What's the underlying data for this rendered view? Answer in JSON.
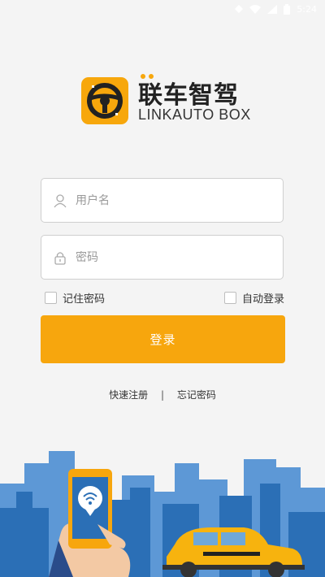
{
  "status": {
    "time": "5:24"
  },
  "brand": {
    "name_cn": "联车智驾",
    "name_en": "LINKAUTO BOX"
  },
  "form": {
    "username_placeholder": "用户名",
    "password_placeholder": "密码",
    "remember_label": "记住密码",
    "auto_login_label": "自动登录",
    "login_label": "登录"
  },
  "links": {
    "register": "快速注册",
    "separator": "|",
    "forgot": "忘记密码"
  },
  "colors": {
    "accent": "#f7a60d",
    "city": "#2b6fb6",
    "city_light": "#5d98d6"
  }
}
